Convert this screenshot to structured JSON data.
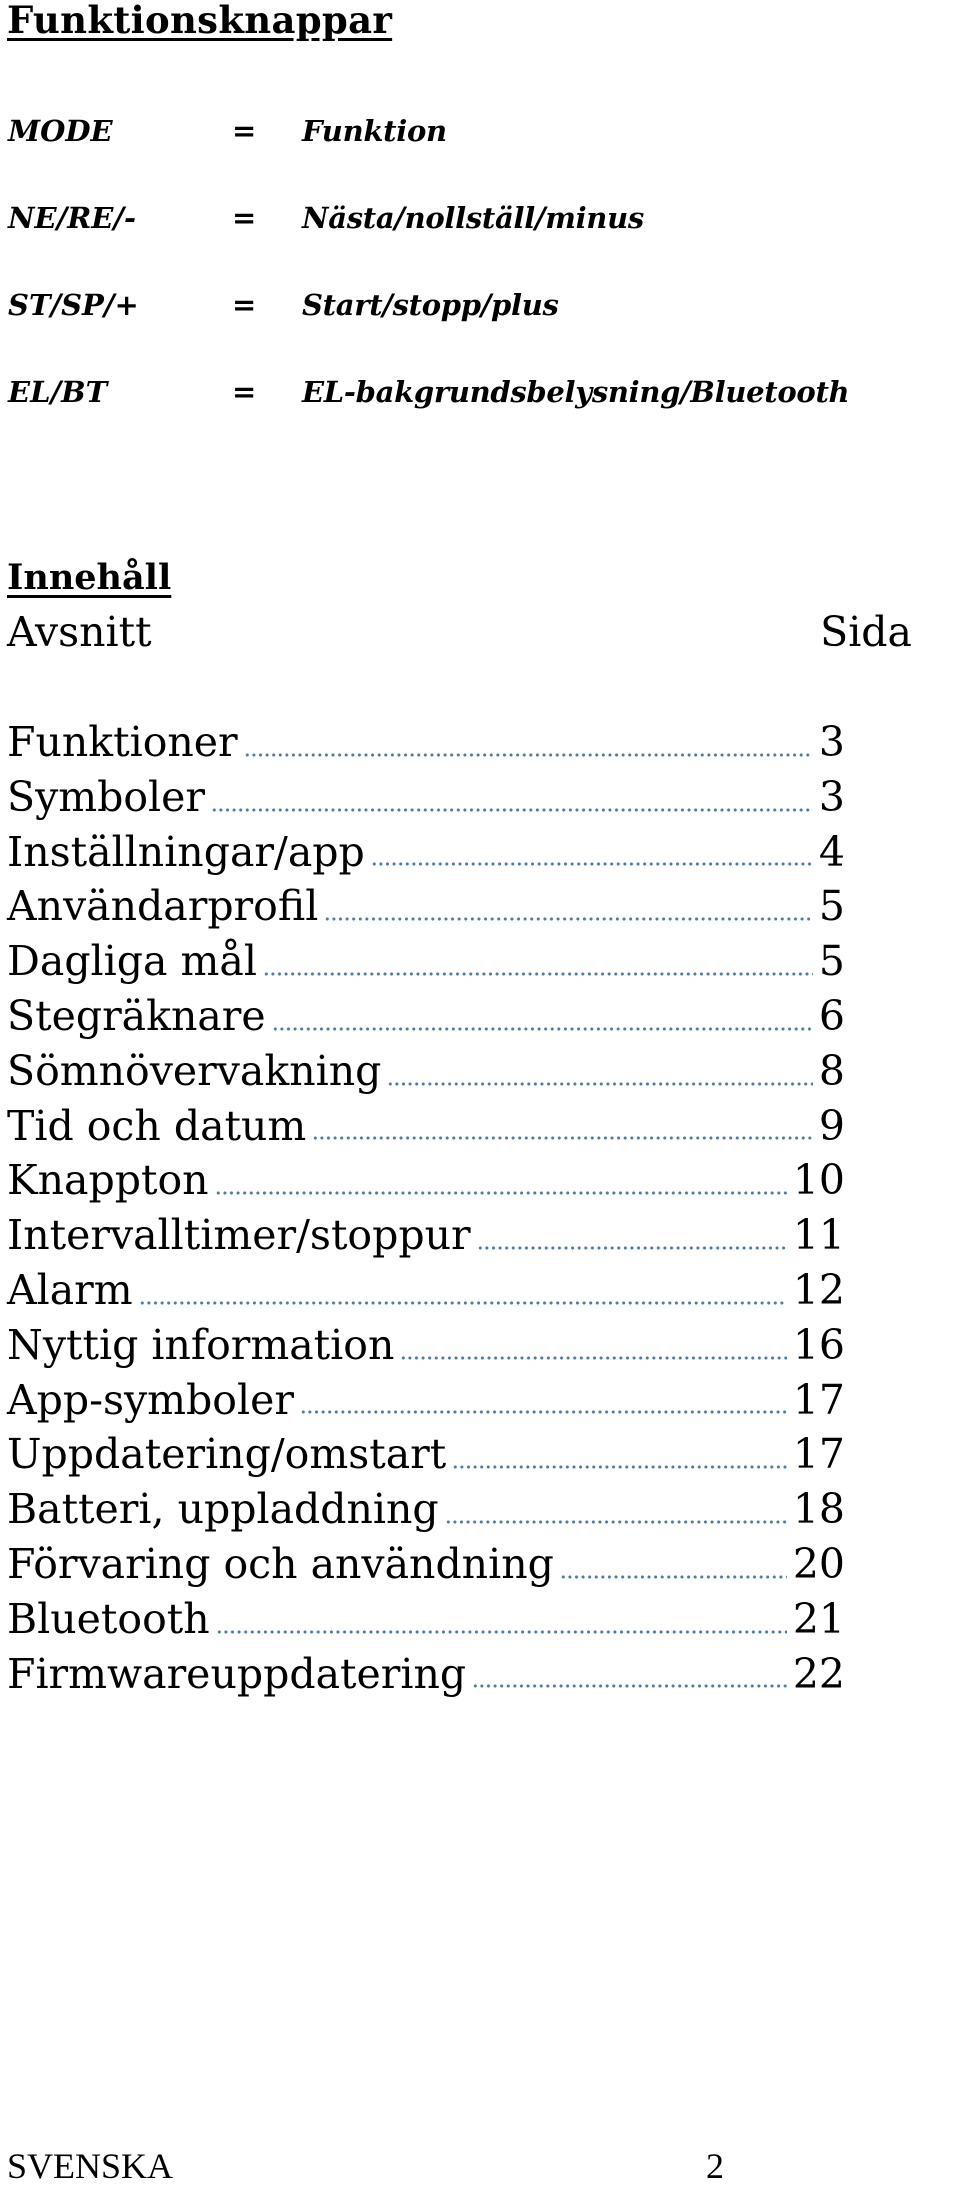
{
  "function_buttons": {
    "title": "Funktionsknappar",
    "rows": [
      {
        "code": "MODE",
        "eq": "=",
        "desc": "Funktion"
      },
      {
        "code": "NE/RE/-",
        "eq": "=",
        "desc": "Nästa/nollställ/minus"
      },
      {
        "code": "ST/SP/+",
        "eq": "=",
        "desc": "Start/stopp/plus"
      },
      {
        "code": "EL/BT",
        "eq": "=",
        "desc": "EL-bakgrundsbelysning/Bluetooth"
      }
    ]
  },
  "contents": {
    "title": "Innehåll",
    "col_section": "Avsnitt",
    "col_page": "Sida",
    "leader_color": "#4a7aa8",
    "entries": [
      {
        "label": "Funktioner",
        "page": "3"
      },
      {
        "label": "Symboler",
        "page": "3"
      },
      {
        "label": "Inställningar/app",
        "page": "4"
      },
      {
        "label": "Användarprofil",
        "page": "5"
      },
      {
        "label": "Dagliga mål",
        "page": "5"
      },
      {
        "label": "Stegräknare",
        "page": "6"
      },
      {
        "label": "Sömnövervakning",
        "page": "8"
      },
      {
        "label": "Tid och datum",
        "page": "9"
      },
      {
        "label": "Knappton",
        "page": "10"
      },
      {
        "label": "Intervalltimer/stoppur",
        "page": "11"
      },
      {
        "label": "Alarm",
        "page": "12"
      },
      {
        "label": "Nyttig information",
        "page": "16"
      },
      {
        "label": "App-symboler",
        "page": "17"
      },
      {
        "label": "Uppdatering/omstart",
        "page": "17"
      },
      {
        "label": "Batteri, uppladdning",
        "page": "18"
      },
      {
        "label": "Förvaring och användning",
        "page": "20"
      },
      {
        "label": "Bluetooth",
        "page": "21"
      },
      {
        "label": "Firmwareuppdatering",
        "page": "22"
      }
    ]
  },
  "footer": {
    "language": "SVENSKA",
    "page_number": "2"
  }
}
